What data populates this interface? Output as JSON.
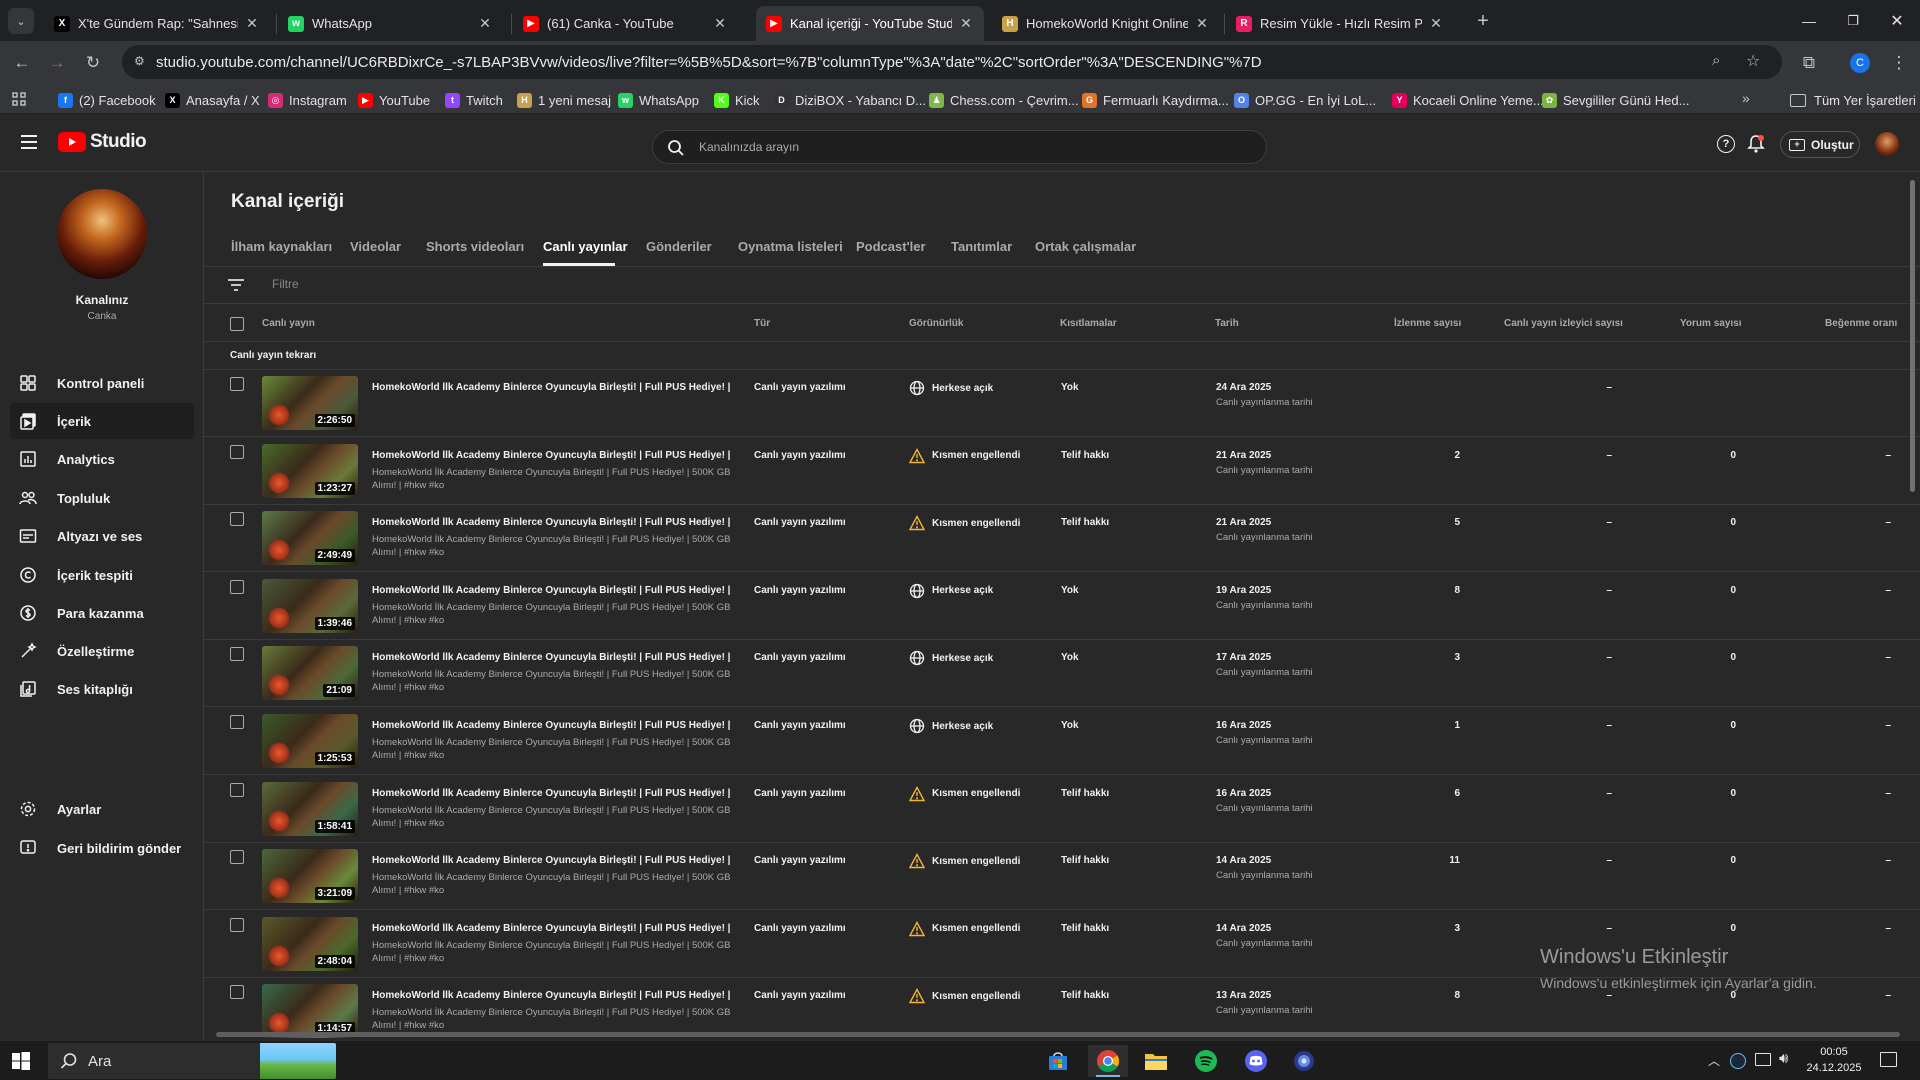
{
  "browser": {
    "tabs": [
      {
        "title": "X'te Gündem Rap: \"Sahnesinde...",
        "icon": "x-logo-icon",
        "color": "#000000"
      },
      {
        "title": "WhatsApp",
        "icon": "whatsapp-icon",
        "color": "#25d366"
      },
      {
        "title": "(61) Canka - YouTube",
        "icon": "youtube-icon",
        "color": "#ff0000"
      },
      {
        "title": "Kanal içeriği - YouTube Studio",
        "icon": "youtube-studio-icon",
        "color": "#ff0000",
        "active": true
      },
      {
        "title": "HomekoWorld Knight Online P...",
        "icon": "homeko-icon",
        "color": "#c8a24a"
      },
      {
        "title": "Resim Yükle - Hızlı Resim Paylaş",
        "icon": "resim-icon",
        "color": "#e91e63"
      }
    ],
    "url": "studio.youtube.com/channel/UC6RBDixrCe_-s7LBAP3BVvw/videos/live?filter=%5B%5D&sort=%7B\"columnType\"%3A\"date\"%2C\"sortOrder\"%3A\"DESCENDING\"%7D",
    "profile_initial": "C",
    "bookmarks": [
      {
        "label": "(2) Facebook",
        "color": "#1877f2",
        "glyph": "f"
      },
      {
        "label": "Anasayfa / X",
        "color": "#000000",
        "glyph": "X"
      },
      {
        "label": "Instagram",
        "color": "#d62976",
        "glyph": "◎"
      },
      {
        "label": "YouTube",
        "color": "#ff0000",
        "glyph": "▶"
      },
      {
        "label": "Twitch",
        "color": "#9146ff",
        "glyph": "t"
      },
      {
        "label": "1 yeni mesaj",
        "color": "#c8a24a",
        "glyph": "H"
      },
      {
        "label": "WhatsApp",
        "color": "#25d366",
        "glyph": "w"
      },
      {
        "label": "Kick",
        "color": "#53fc18",
        "glyph": "K"
      },
      {
        "label": "DiziBOX - Yabancı D...",
        "color": "#333333",
        "glyph": "D"
      },
      {
        "label": "Chess.com - Çevrim...",
        "color": "#81b64c",
        "glyph": "♟"
      },
      {
        "label": "Fermuarlı Kaydırma...",
        "color": "#e0742a",
        "glyph": "G"
      },
      {
        "label": "OP.GG - En İyi LoL...",
        "color": "#5383e8",
        "glyph": "O"
      },
      {
        "label": "Kocaeli Online Yeme...",
        "color": "#e3005b",
        "glyph": "Y"
      },
      {
        "label": "Sevgililer Günü Hed...",
        "color": "#7cb342",
        "glyph": "✿"
      }
    ],
    "all_bookmarks": "Tüm Yer İşaretleri"
  },
  "studio": {
    "logo_text": "Studio",
    "search_placeholder": "Kanalınızda arayın",
    "create_label": "Oluştur",
    "channel": {
      "heading": "Kanalınız",
      "name": "Canka"
    },
    "nav": [
      {
        "label": "Kontrol paneli",
        "icon": "dashboard-icon"
      },
      {
        "label": "İçerik",
        "icon": "content-icon",
        "active": true
      },
      {
        "label": "Analytics",
        "icon": "analytics-icon"
      },
      {
        "label": "Topluluk",
        "icon": "community-icon"
      },
      {
        "label": "Altyazı ve ses",
        "icon": "subtitles-icon"
      },
      {
        "label": "İçerik tespiti",
        "icon": "copyright-icon"
      },
      {
        "label": "Para kazanma",
        "icon": "monetization-icon"
      },
      {
        "label": "Özelleştirme",
        "icon": "customization-icon"
      },
      {
        "label": "Ses kitaplığı",
        "icon": "audio-library-icon"
      }
    ],
    "nav_bottom": [
      {
        "label": "Ayarlar",
        "icon": "settings-icon"
      },
      {
        "label": "Geri bildirim gönder",
        "icon": "feedback-icon"
      }
    ],
    "page_title": "Kanal içeriği",
    "content_tabs": [
      "İlham kaynakları",
      "Videolar",
      "Shorts videoları",
      "Canlı yayınlar",
      "Gönderiler",
      "Oynatma listeleri",
      "Podcast'ler",
      "Tanıtımlar",
      "Ortak çalışmalar"
    ],
    "active_tab": "Canlı yayınlar",
    "filter_placeholder": "Filtre",
    "columns": [
      "Canlı yayın",
      "Tür",
      "Görünürlük",
      "Kısıtlamalar",
      "Tarih",
      "İzlenme sayısı",
      "Canlı yayın izleyici sayısı",
      "Yorum sayısı",
      "Beğenme oranı"
    ],
    "section_label": "Canlı yayın tekrarı",
    "rows": [
      {
        "title": "HomekoWorld İlk Academy Binlerce Oyuncuyla Birleşti! | Full PUS Hediye! | ...",
        "desc": "",
        "duration": "2:26:50",
        "type": "Canlı yayın yazılımı",
        "visibility": "Herkese açık",
        "vis_icon": "globe-icon",
        "restriction": "Yok",
        "date": "24 Ara 2025",
        "date_sub": "Canlı yayınlanma tarihi",
        "views": "",
        "live_viewers": "–",
        "comments": "",
        "like_ratio": ""
      },
      {
        "title": "HomekoWorld İlk Academy Binlerce Oyuncuyla Birleşti! | Full PUS Hediye! | ...",
        "desc": "HomekoWorld İlk Academy Binlerce Oyuncuyla Birleşti! | Full PUS Hediye! | 500K GB Alımı! | #hkw #ko",
        "duration": "1:23:27",
        "type": "Canlı yayın yazılımı",
        "visibility": "Kısmen engellendi",
        "vis_icon": "warning-icon",
        "restriction": "Telif hakkı",
        "date": "21 Ara 2025",
        "date_sub": "Canlı yayınlanma tarihi",
        "views": "2",
        "live_viewers": "–",
        "comments": "0",
        "like_ratio": "–"
      },
      {
        "title": "HomekoWorld İlk Academy Binlerce Oyuncuyla Birleşti! | Full PUS Hediye! | ...",
        "desc": "HomekoWorld İlk Academy Binlerce Oyuncuyla Birleşti! | Full PUS Hediye! | 500K GB Alımı! | #hkw #ko",
        "duration": "2:49:49",
        "type": "Canlı yayın yazılımı",
        "visibility": "Kısmen engellendi",
        "vis_icon": "warning-icon",
        "restriction": "Telif hakkı",
        "date": "21 Ara 2025",
        "date_sub": "Canlı yayınlanma tarihi",
        "views": "5",
        "live_viewers": "–",
        "comments": "0",
        "like_ratio": "–"
      },
      {
        "title": "HomekoWorld İlk Academy Binlerce Oyuncuyla Birleşti! | Full PUS Hediye! | ...",
        "desc": "HomekoWorld İlk Academy Binlerce Oyuncuyla Birleşti! | Full PUS Hediye! | 500K GB Alımı! | #hkw #ko",
        "duration": "1:39:46",
        "type": "Canlı yayın yazılımı",
        "visibility": "Herkese açık",
        "vis_icon": "globe-icon",
        "restriction": "Yok",
        "date": "19 Ara 2025",
        "date_sub": "Canlı yayınlanma tarihi",
        "views": "8",
        "live_viewers": "–",
        "comments": "0",
        "like_ratio": "–"
      },
      {
        "title": "HomekoWorld İlk Academy Binlerce Oyuncuyla Birleşti! | Full PUS Hediye! | ...",
        "desc": "HomekoWorld İlk Academy Binlerce Oyuncuyla Birleşti! | Full PUS Hediye! | 500K GB Alımı! | #hkw #ko",
        "duration": "21:09",
        "type": "Canlı yayın yazılımı",
        "visibility": "Herkese açık",
        "vis_icon": "globe-icon",
        "restriction": "Yok",
        "date": "17 Ara 2025",
        "date_sub": "Canlı yayınlanma tarihi",
        "views": "3",
        "live_viewers": "–",
        "comments": "0",
        "like_ratio": "–"
      },
      {
        "title": "HomekoWorld İlk Academy Binlerce Oyuncuyla Birleşti! | Full PUS Hediye! | ...",
        "desc": "HomekoWorld İlk Academy Binlerce Oyuncuyla Birleşti! | Full PUS Hediye! | 500K GB Alımı! | #hkw #ko",
        "duration": "1:25:53",
        "type": "Canlı yayın yazılımı",
        "visibility": "Herkese açık",
        "vis_icon": "globe-icon",
        "restriction": "Yok",
        "date": "16 Ara 2025",
        "date_sub": "Canlı yayınlanma tarihi",
        "views": "1",
        "live_viewers": "–",
        "comments": "0",
        "like_ratio": "–"
      },
      {
        "title": "HomekoWorld İlk Academy Binlerce Oyuncuyla Birleşti! | Full PUS Hediye! | ...",
        "desc": "HomekoWorld İlk Academy Binlerce Oyuncuyla Birleşti! | Full PUS Hediye! | 500K GB Alımı! | #hkw #ko",
        "duration": "1:58:41",
        "type": "Canlı yayın yazılımı",
        "visibility": "Kısmen engellendi",
        "vis_icon": "warning-icon",
        "restriction": "Telif hakkı",
        "date": "16 Ara 2025",
        "date_sub": "Canlı yayınlanma tarihi",
        "views": "6",
        "live_viewers": "–",
        "comments": "0",
        "like_ratio": "–"
      },
      {
        "title": "HomekoWorld İlk Academy Binlerce Oyuncuyla Birleşti! | Full PUS Hediye! | ...",
        "desc": "HomekoWorld İlk Academy Binlerce Oyuncuyla Birleşti! | Full PUS Hediye! | 500K GB Alımı! | #hkw #ko",
        "duration": "3:21:09",
        "type": "Canlı yayın yazılımı",
        "visibility": "Kısmen engellendi",
        "vis_icon": "warning-icon",
        "restriction": "Telif hakkı",
        "date": "14 Ara 2025",
        "date_sub": "Canlı yayınlanma tarihi",
        "views": "11",
        "live_viewers": "–",
        "comments": "0",
        "like_ratio": "–"
      },
      {
        "title": "HomekoWorld İlk Academy Binlerce Oyuncuyla Birleşti! | Full PUS Hediye! | ...",
        "desc": "HomekoWorld İlk Academy Binlerce Oyuncuyla Birleşti! | Full PUS Hediye! | 500K GB Alımı! | #hkw #ko",
        "duration": "2:48:04",
        "type": "Canlı yayın yazılımı",
        "visibility": "Kısmen engellendi",
        "vis_icon": "warning-icon",
        "restriction": "Telif hakkı",
        "date": "14 Ara 2025",
        "date_sub": "Canlı yayınlanma tarihi",
        "views": "3",
        "live_viewers": "–",
        "comments": "0",
        "like_ratio": "–"
      },
      {
        "title": "HomekoWorld İlk Academy Binlerce Oyuncuyla Birleşti! | Full PUS Hediye! | ...",
        "desc": "HomekoWorld İlk Academy Binlerce Oyuncuyla Birleşti! | Full PUS Hediye! | 500K GB Alımı! | #hkw #ko",
        "duration": "1:14:57",
        "type": "Canlı yayın yazılımı",
        "visibility": "Kısmen engellendi",
        "vis_icon": "warning-icon",
        "restriction": "Telif hakkı",
        "date": "13 Ara 2025",
        "date_sub": "Canlı yayınlanma tarihi",
        "views": "8",
        "live_viewers": "–",
        "comments": "0",
        "like_ratio": "–"
      }
    ]
  },
  "watermark": {
    "title": "Windows'u Etkinleştir",
    "subtitle": "Windows'u etkinleştirmek için Ayarlar'a gidin."
  },
  "taskbar": {
    "search_placeholder": "Ara",
    "apps": [
      {
        "name": "store-icon",
        "running": false
      },
      {
        "name": "chrome-icon",
        "running": true
      },
      {
        "name": "file-explorer-icon",
        "running": false
      },
      {
        "name": "spotify-icon",
        "running": false
      },
      {
        "name": "discord-icon",
        "running": false
      },
      {
        "name": "app-icon",
        "running": false
      }
    ],
    "time": "00:05",
    "date": "24.12.2025"
  }
}
